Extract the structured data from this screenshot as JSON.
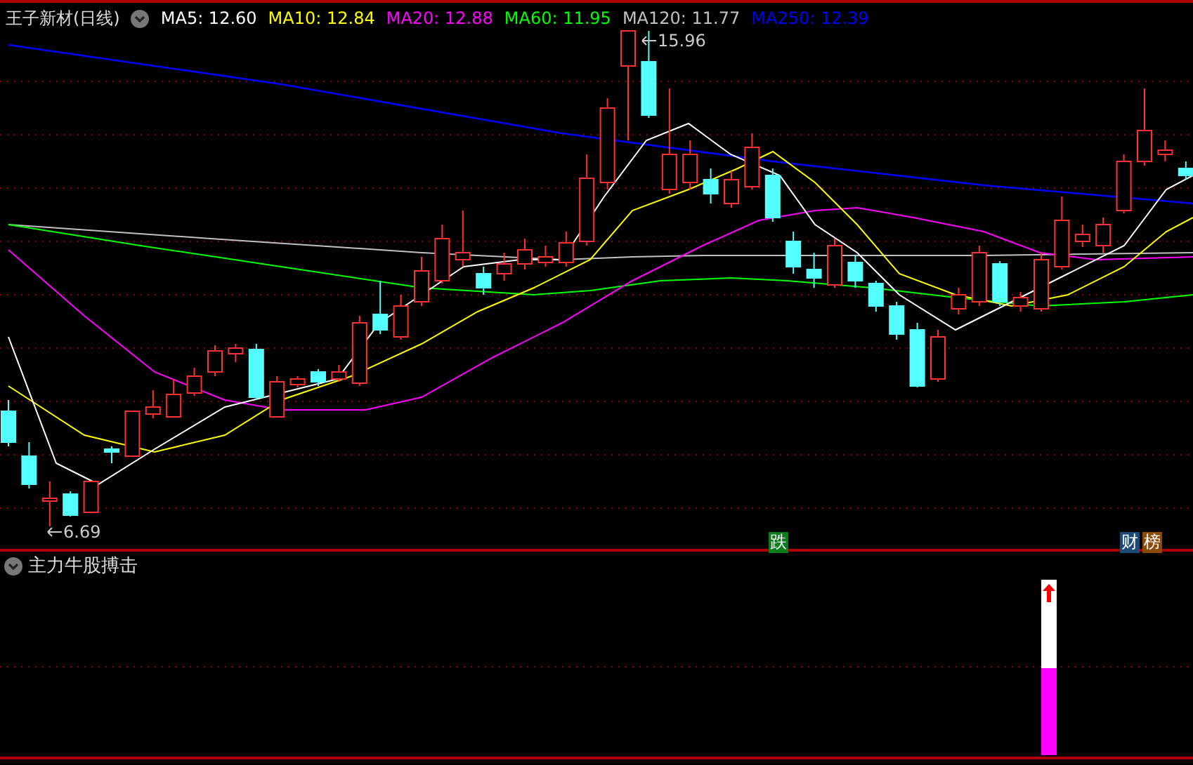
{
  "header": {
    "title": "王子新材(日线)",
    "legend": [
      {
        "label": "MA5: 12.60",
        "color": "#ffffff"
      },
      {
        "label": "MA10: 12.84",
        "color": "#ffff00"
      },
      {
        "label": "MA20: 12.88",
        "color": "#ff00ff"
      },
      {
        "label": "MA60: 11.95",
        "color": "#00ff00"
      },
      {
        "label": "MA120: 11.77",
        "color": "#c0c0c0"
      },
      {
        "label": "MA250: 12.39",
        "color": "#0000ff"
      }
    ]
  },
  "price_labels": [
    {
      "kind": "high",
      "text": "15.96"
    },
    {
      "kind": "low",
      "text": "6.69"
    }
  ],
  "markers": [
    {
      "text": "跌",
      "color": "#0b7d1a"
    },
    {
      "text": "财",
      "color": "#1c4a78"
    },
    {
      "text": "榜",
      "color": "#8a4a0c"
    }
  ],
  "indicator": {
    "title": "主力牛股搏击",
    "level": 0.5
  }
}
